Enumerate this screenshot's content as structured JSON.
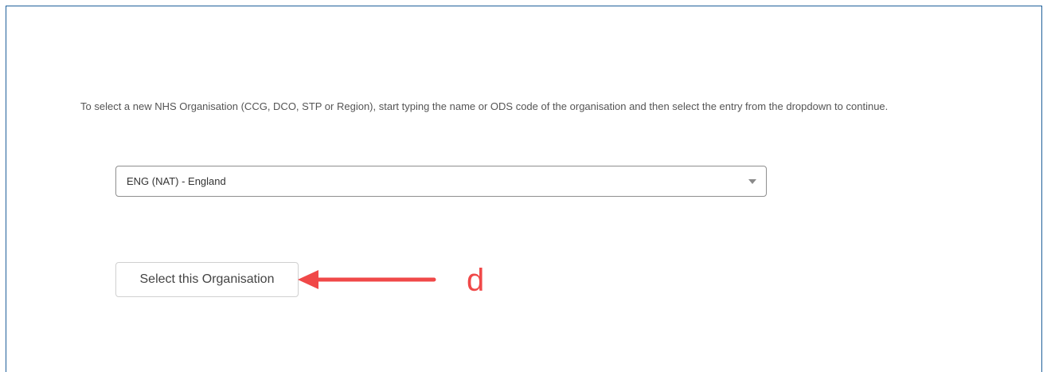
{
  "instructions": {
    "text": "To select a new NHS Organisation (CCG, DCO, STP or Region), start typing the name or ODS code of the organisation and then select the entry from the dropdown to continue."
  },
  "org_select": {
    "selected_value": "ENG (NAT) - England",
    "icon": "caret-down-icon"
  },
  "select_button": {
    "label": "Select this Organisation"
  },
  "annotation": {
    "letter": "d",
    "color": "#f04848"
  }
}
